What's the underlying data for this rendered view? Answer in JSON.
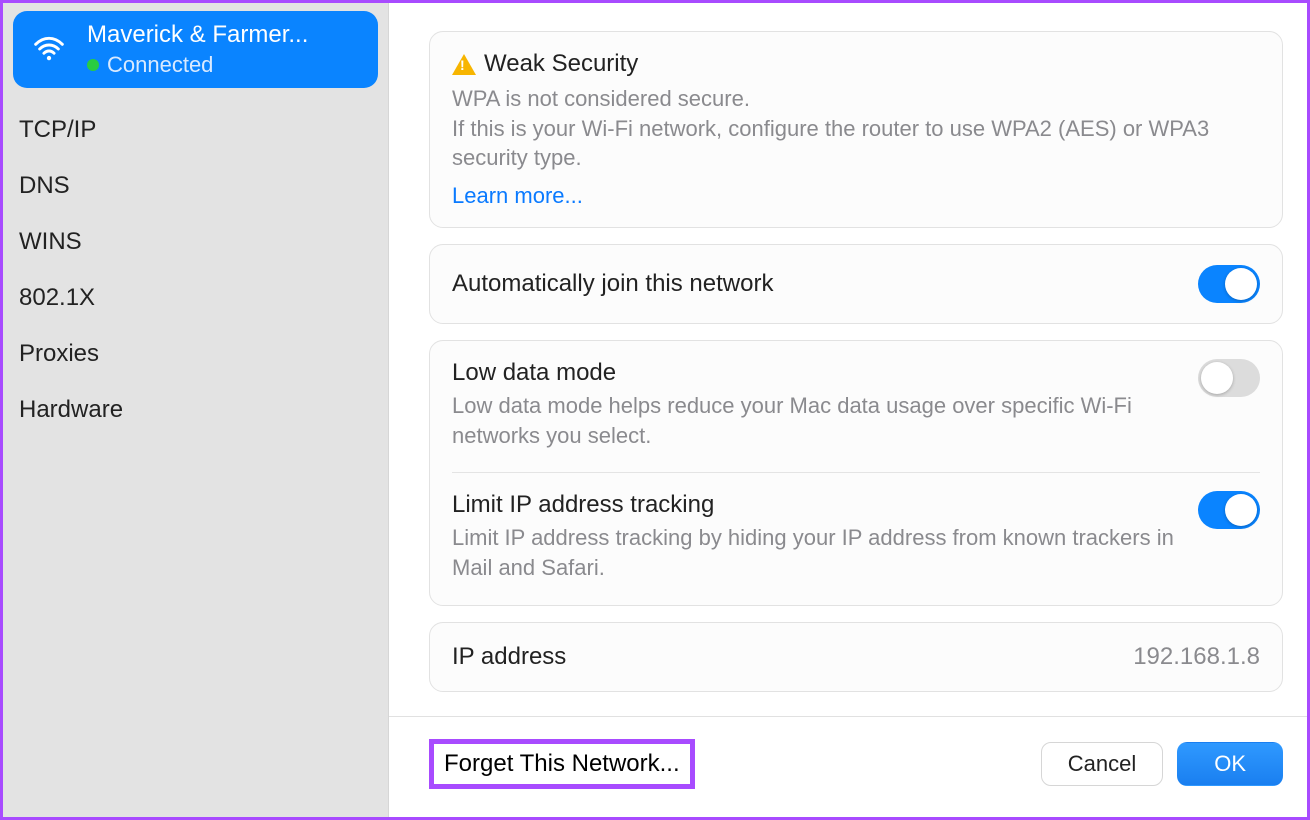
{
  "sidebar": {
    "network_name": "Maverick & Farmer...",
    "status": "Connected",
    "items": [
      {
        "label": "TCP/IP"
      },
      {
        "label": "DNS"
      },
      {
        "label": "WINS"
      },
      {
        "label": "802.1X"
      },
      {
        "label": "Proxies"
      },
      {
        "label": "Hardware"
      }
    ]
  },
  "security": {
    "heading": "Weak Security",
    "line1": "WPA is not considered secure.",
    "line2": "If this is your Wi-Fi network, configure the router to use WPA2 (AES) or WPA3 security type.",
    "learn_more": "Learn more..."
  },
  "auto_join": {
    "label": "Automatically join this network",
    "on": true
  },
  "low_data": {
    "label": "Low data mode",
    "desc": "Low data mode helps reduce your Mac data usage over specific Wi-Fi networks you select.",
    "on": false
  },
  "limit_ip": {
    "label": "Limit IP address tracking",
    "desc": "Limit IP address tracking by hiding your IP address from known trackers in Mail and Safari.",
    "on": true
  },
  "ip": {
    "label": "IP address",
    "value": "192.168.1.8"
  },
  "footer": {
    "forget": "Forget This Network...",
    "cancel": "Cancel",
    "ok": "OK"
  }
}
